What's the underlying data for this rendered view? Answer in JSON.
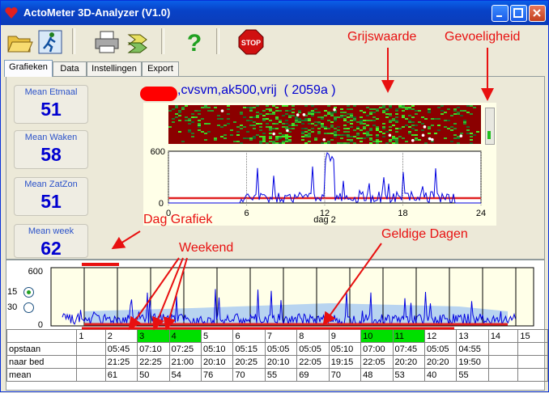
{
  "window": {
    "title": "ActoMeter 3D-Analyzer   (V1.0)"
  },
  "tabs": [
    {
      "label": "Grafieken"
    },
    {
      "label": "Data"
    },
    {
      "label": "Instellingen"
    },
    {
      "label": "Export"
    }
  ],
  "stats": [
    {
      "label": "Mean Etmaal",
      "value": "51"
    },
    {
      "label": "Mean Waken",
      "value": "58"
    },
    {
      "label": "Mean ZatZon",
      "value": "51"
    },
    {
      "label": "Mean week",
      "value": "62"
    }
  ],
  "heading": ",cvsvm,ak500,vrij  ( 2059a )",
  "annotations": {
    "grijswaarde": "Grijswaarde",
    "gevoeligheid": "Gevoeligheid",
    "dag_grafiek": "Dag Grafiek",
    "weekend": "Weekend",
    "geldige_dagen": "Geldige Dagen"
  },
  "day_chart": {
    "y_top": "600",
    "y_bottom": "0",
    "x_ticks": [
      "0",
      "6",
      "12",
      "18",
      "24"
    ],
    "xlabel": "dag 2"
  },
  "week_chart": {
    "y_top": "600",
    "y_bottom": "0",
    "radio_15": "15",
    "radio_30": "30",
    "selected_radio": "15"
  },
  "table": {
    "days": [
      "1",
      "2",
      "3",
      "4",
      "5",
      "6",
      "7",
      "8",
      "9",
      "10",
      "11",
      "12",
      "13",
      "14",
      "15"
    ],
    "weekend_days": [
      "3",
      "4",
      "10",
      "11"
    ],
    "rows": [
      {
        "label": "opstaan",
        "values": [
          "",
          "05:45",
          "07:10",
          "07:25",
          "05:10",
          "05:15",
          "05:05",
          "05:05",
          "05:10",
          "07:00",
          "07:45",
          "05:05",
          "04:55",
          "",
          ""
        ]
      },
      {
        "label": "naar bed",
        "values": [
          "",
          "21:25",
          "22:25",
          "21:00",
          "20:10",
          "20:25",
          "20:10",
          "22:05",
          "19:15",
          "22:05",
          "20:20",
          "20:20",
          "19:50",
          "",
          ""
        ]
      },
      {
        "label": "mean",
        "values": [
          "",
          "61",
          "50",
          "54",
          "76",
          "70",
          "55",
          "69",
          "70",
          "48",
          "53",
          "40",
          "55",
          "",
          ""
        ]
      }
    ]
  },
  "colors": {
    "accent_blue": "#0000D0",
    "annotation_red": "#E81010",
    "weekend_green": "#00E000"
  }
}
